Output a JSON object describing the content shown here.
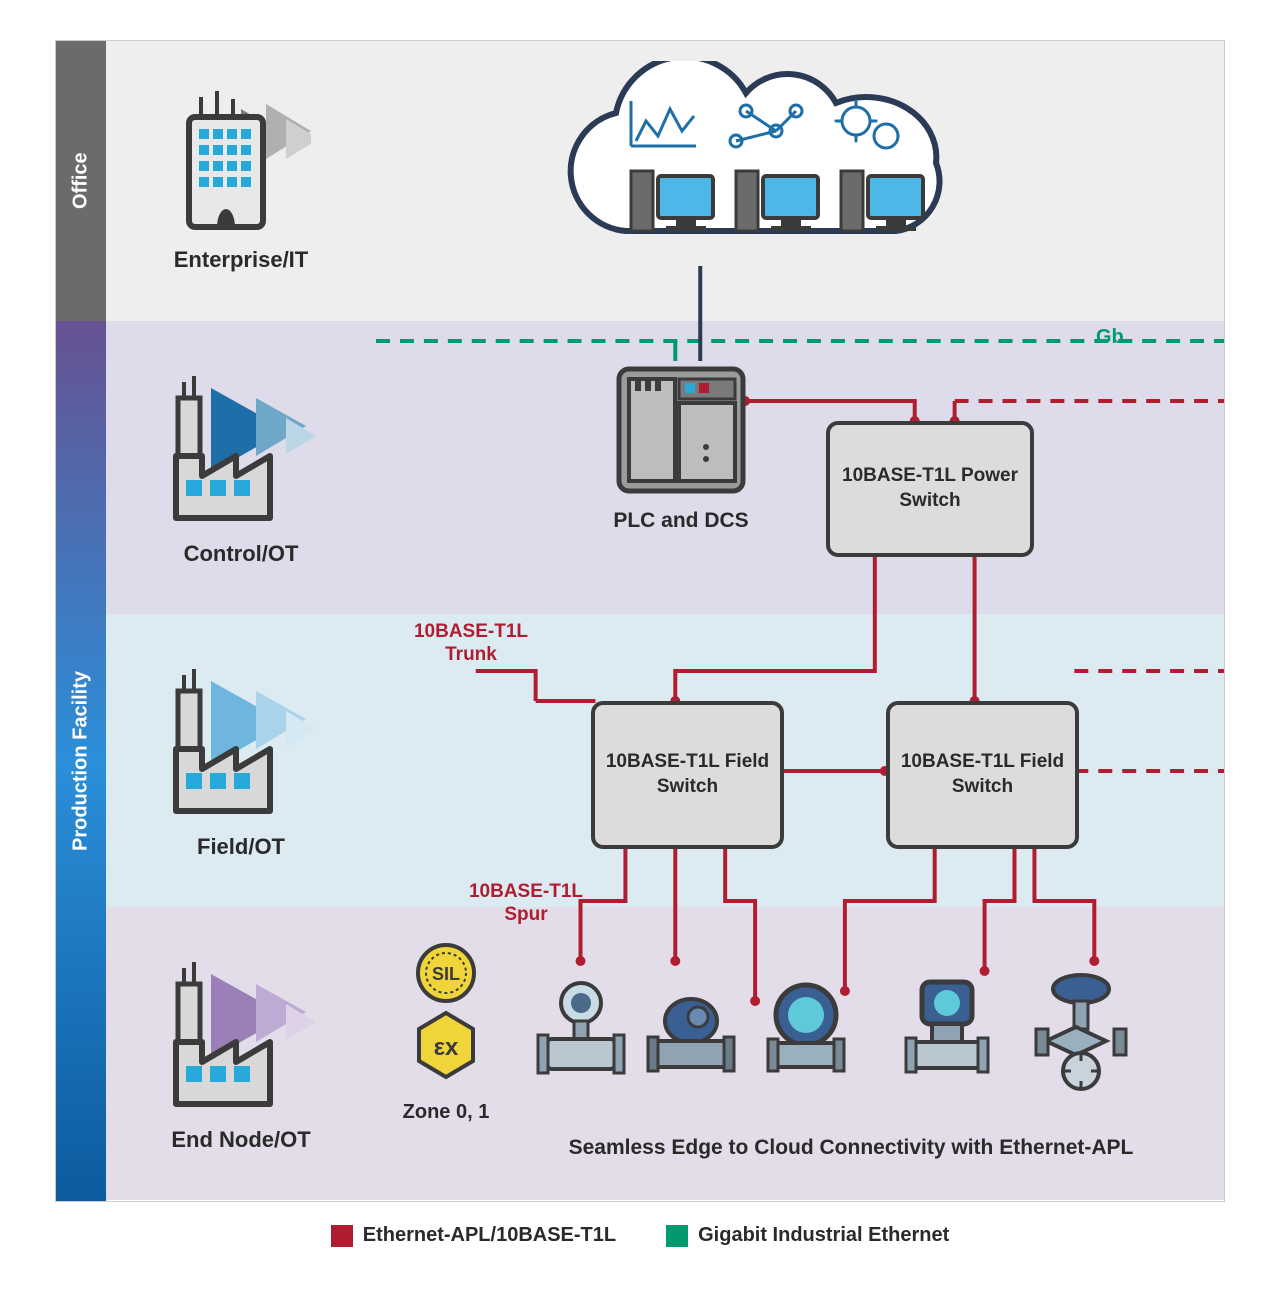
{
  "sidebar": {
    "office": "Office",
    "prod": "Production Facility"
  },
  "rows": {
    "office": "Enterprise/IT",
    "control": "Control/OT",
    "field": "Field/OT",
    "end": "End Node/OT"
  },
  "boxes": {
    "power": "10BASE-T1L Power Switch",
    "fs1": "10BASE-T1L Field Switch",
    "fs2": "10BASE-T1L Field Switch",
    "plc": "PLC and DCS"
  },
  "labels": {
    "trunk": "10BASE-T1L Trunk",
    "spur": "10BASE-T1L Spur",
    "gb": "Gb",
    "zone": "Zone 0, 1",
    "sil": "SIL",
    "ex": "Ex",
    "caption": "Seamless Edge to Cloud Connectivity with Ethernet-APL"
  },
  "legend": {
    "red": "Ethernet-APL/10BASE-T1L",
    "green": "Gigabit Industrial Ethernet"
  },
  "colors": {
    "red": "#b01d31",
    "green": "#009a6e",
    "navy": "#2b3b56"
  }
}
